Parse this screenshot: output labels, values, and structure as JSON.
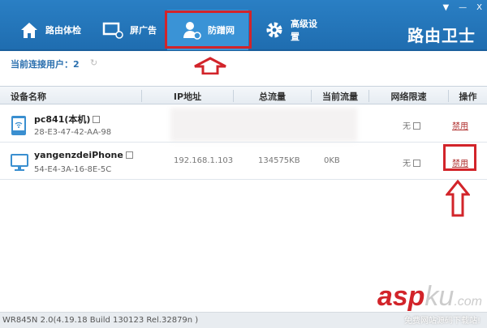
{
  "window": {
    "menu_icon": "▼",
    "minimize_icon": "—",
    "close_icon": "X"
  },
  "tabs": [
    {
      "label": "路由体检",
      "icon": "home-icon"
    },
    {
      "label": "屏广告",
      "icon": "ad-block-icon"
    },
    {
      "label": "防蹭网",
      "icon": "user-block-icon"
    },
    {
      "label": "高级设置",
      "icon": "gear-icon"
    }
  ],
  "logo": "路由卫士",
  "status": {
    "label": "当前连接用户：2",
    "refresh_icon": "↻"
  },
  "table": {
    "headers": [
      "设备名称",
      "IP地址",
      "总流量",
      "当前流量",
      "网络限速",
      "操作"
    ],
    "rows": [
      {
        "name": "pc841(本机)",
        "mac": "28-E3-47-42-AA-98",
        "ip": "",
        "total": "",
        "current": "",
        "limit": "无",
        "action": "禁用"
      },
      {
        "name": "yangenzdeiPhone",
        "mac": "54-E4-3A-16-8E-5C",
        "ip": "192.168.1.103",
        "total": "134575KB",
        "current": "0KB",
        "limit": "无",
        "action": "禁用"
      }
    ]
  },
  "footer": "WR845N 2.0(4.19.18 Build 130123 Rel.32879n )",
  "watermark": {
    "brand": "asp",
    "brand2": "ku",
    "suffix": ".com",
    "tagline": "免费网站源码下载站!"
  },
  "colors": {
    "accent": "#2a7fc4",
    "highlight": "#d2242a",
    "ban": "#b0302f"
  }
}
